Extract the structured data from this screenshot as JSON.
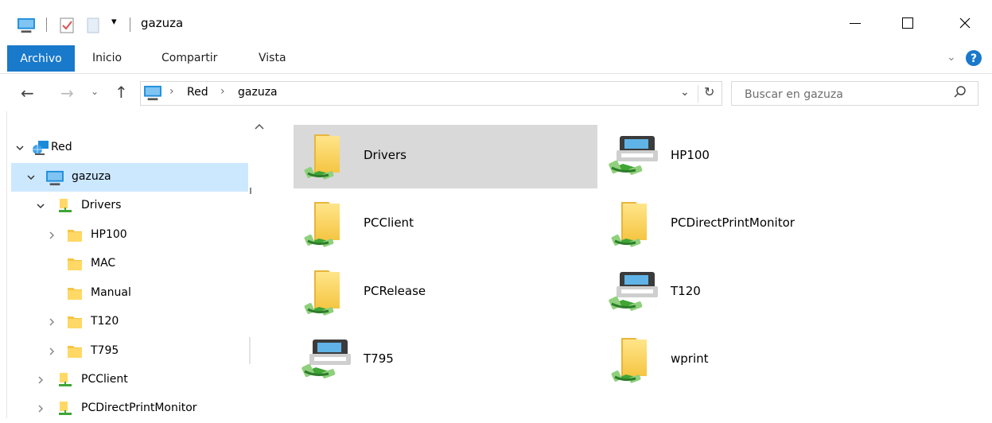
{
  "window": {
    "title": "gazuza"
  },
  "ribbon": {
    "tabs": [
      "Archivo",
      "Inicio",
      "Compartir",
      "Vista"
    ]
  },
  "address": {
    "path": [
      "Red",
      "gazuza"
    ]
  },
  "search": {
    "placeholder": "Buscar en gazuza"
  },
  "tree": {
    "items": [
      {
        "label": "Red",
        "icon": "network-icon",
        "expanded": true
      },
      {
        "label": "gazuza",
        "icon": "computer-icon",
        "expanded": true,
        "selected": true
      },
      {
        "label": "Drivers",
        "icon": "shared-folder-icon",
        "expanded": true
      },
      {
        "label": "HP100",
        "icon": "folder-icon",
        "expanded": false
      },
      {
        "label": "MAC",
        "icon": "folder-icon"
      },
      {
        "label": "Manual",
        "icon": "folder-icon"
      },
      {
        "label": "T120",
        "icon": "folder-icon",
        "expanded": false
      },
      {
        "label": "T795",
        "icon": "folder-icon",
        "expanded": false
      },
      {
        "label": "PCClient",
        "icon": "shared-folder-icon",
        "expanded": false
      },
      {
        "label": "PCDirectPrintMonitor",
        "icon": "shared-folder-icon",
        "expanded": false
      }
    ]
  },
  "content": {
    "items": [
      {
        "label": "Drivers",
        "icon": "shared-folder-icon",
        "selected": true
      },
      {
        "label": "HP100",
        "icon": "shared-printer-icon"
      },
      {
        "label": "PCClient",
        "icon": "shared-folder-icon"
      },
      {
        "label": "PCDirectPrintMonitor",
        "icon": "shared-folder-icon"
      },
      {
        "label": "PCRelease",
        "icon": "shared-folder-icon"
      },
      {
        "label": "T120",
        "icon": "shared-printer-icon"
      },
      {
        "label": "T795",
        "icon": "shared-printer-icon"
      },
      {
        "label": "wprint",
        "icon": "shared-folder-icon"
      }
    ]
  },
  "colors": {
    "accent": "#1979ca",
    "selection_tree": "#cce8ff",
    "selection_item": "#d9d9d9",
    "share_green": "#3fa535"
  }
}
